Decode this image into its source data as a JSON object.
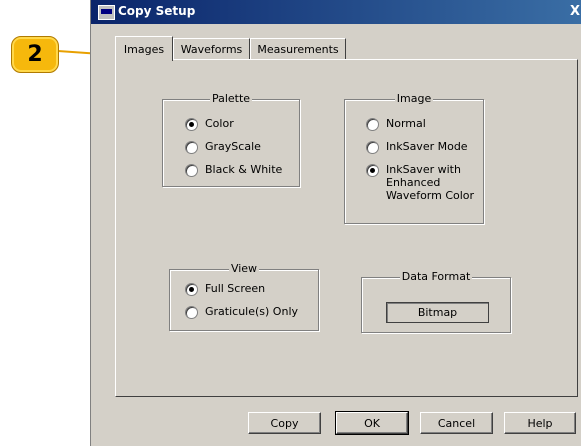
{
  "callout": {
    "number": "2"
  },
  "window": {
    "title": "Copy Setup",
    "close": "X"
  },
  "tabs": [
    {
      "label": "Images",
      "active": true
    },
    {
      "label": "Waveforms",
      "active": false
    },
    {
      "label": "Measurements",
      "active": false
    }
  ],
  "palette": {
    "legend": "Palette",
    "options": [
      {
        "label": "Color",
        "selected": true
      },
      {
        "label": "GrayScale",
        "selected": false
      },
      {
        "label": "Black & White",
        "selected": false
      }
    ]
  },
  "image": {
    "legend": "Image",
    "options": [
      {
        "label": "Normal",
        "selected": false
      },
      {
        "label": "InkSaver Mode",
        "selected": false
      },
      {
        "label": "InkSaver with Enhanced Waveform Color",
        "line1": "InkSaver with",
        "line2": "Enhanced",
        "line3": "Waveform Color",
        "selected": true
      }
    ]
  },
  "view": {
    "legend": "View",
    "options": [
      {
        "label": "Full Screen",
        "selected": true
      },
      {
        "label": "Graticule(s) Only",
        "selected": false
      }
    ]
  },
  "data_format": {
    "legend": "Data Format",
    "value": "Bitmap"
  },
  "buttons": {
    "copy": "Copy",
    "ok": "OK",
    "cancel": "Cancel",
    "help": "Help"
  }
}
